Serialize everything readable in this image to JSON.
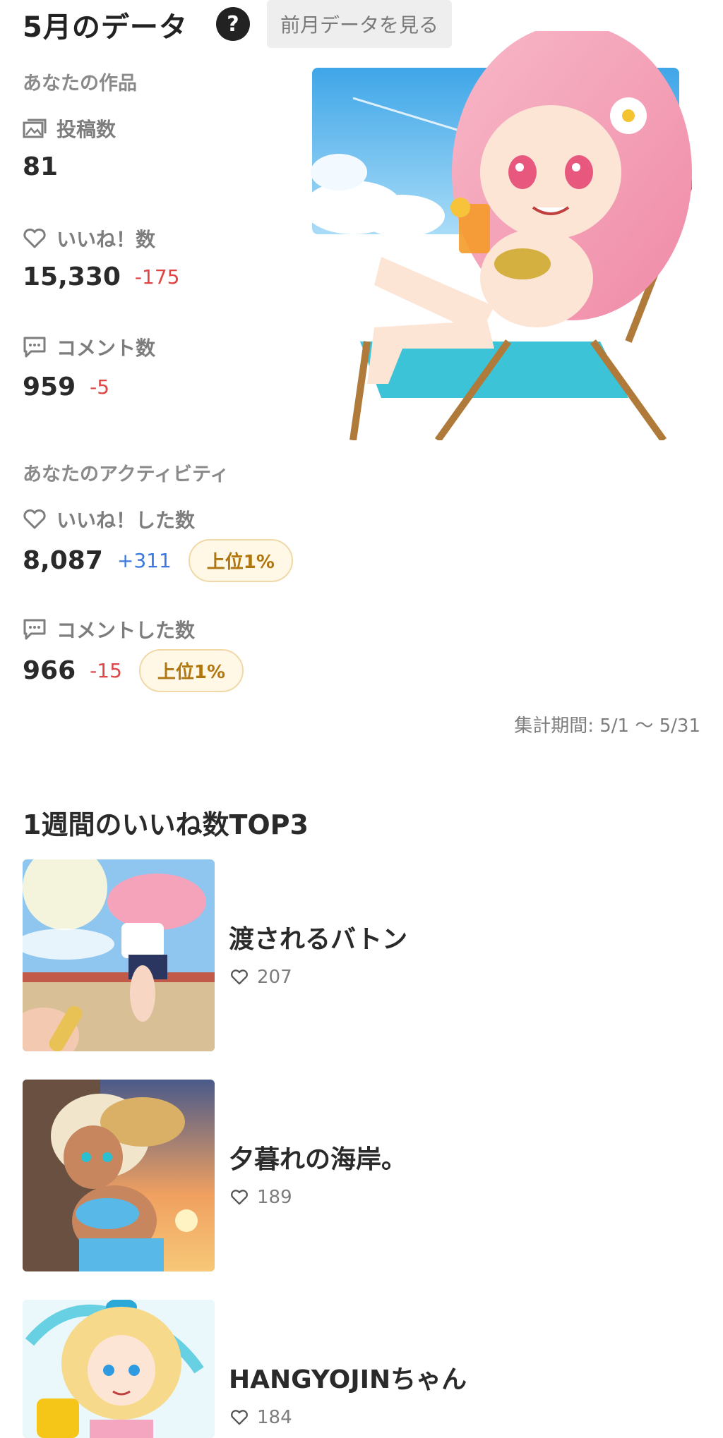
{
  "header": {
    "title": "5月のデータ",
    "help_symbol": "?",
    "prev_button_label": "前月データを見る"
  },
  "works": {
    "section_label": "あなたの作品",
    "posts": {
      "label": "投稿数",
      "value": "81",
      "icon": "gallery-icon"
    },
    "likes": {
      "label": "いいね！数",
      "value": "15,330",
      "diff": "-175",
      "icon": "heart-icon"
    },
    "comments": {
      "label": "コメント数",
      "value": "959",
      "diff": "-5",
      "icon": "comment-icon"
    }
  },
  "activity": {
    "section_label": "あなたのアクティビティ",
    "likes_given": {
      "label": "いいね！した数",
      "value": "8,087",
      "diff": "+311",
      "badge": "上位1%",
      "icon": "heart-icon"
    },
    "comments_given": {
      "label": "コメントした数",
      "value": "966",
      "diff": "-15",
      "badge": "上位1%",
      "icon": "comment-icon"
    }
  },
  "period": "集計期間: 5/1 〜 5/31",
  "top3": {
    "title": "1週間のいいね数TOP3",
    "items": [
      {
        "title": "渡されるバトン",
        "likes": "207"
      },
      {
        "title": "夕暮れの海岸。",
        "likes": "189"
      },
      {
        "title": "HANGYOJINちゃん",
        "likes": "184"
      }
    ]
  },
  "colors": {
    "negative": "#e04545",
    "positive": "#3a78e0",
    "badge_text": "#b07610",
    "badge_bg": "#fff8e6"
  }
}
